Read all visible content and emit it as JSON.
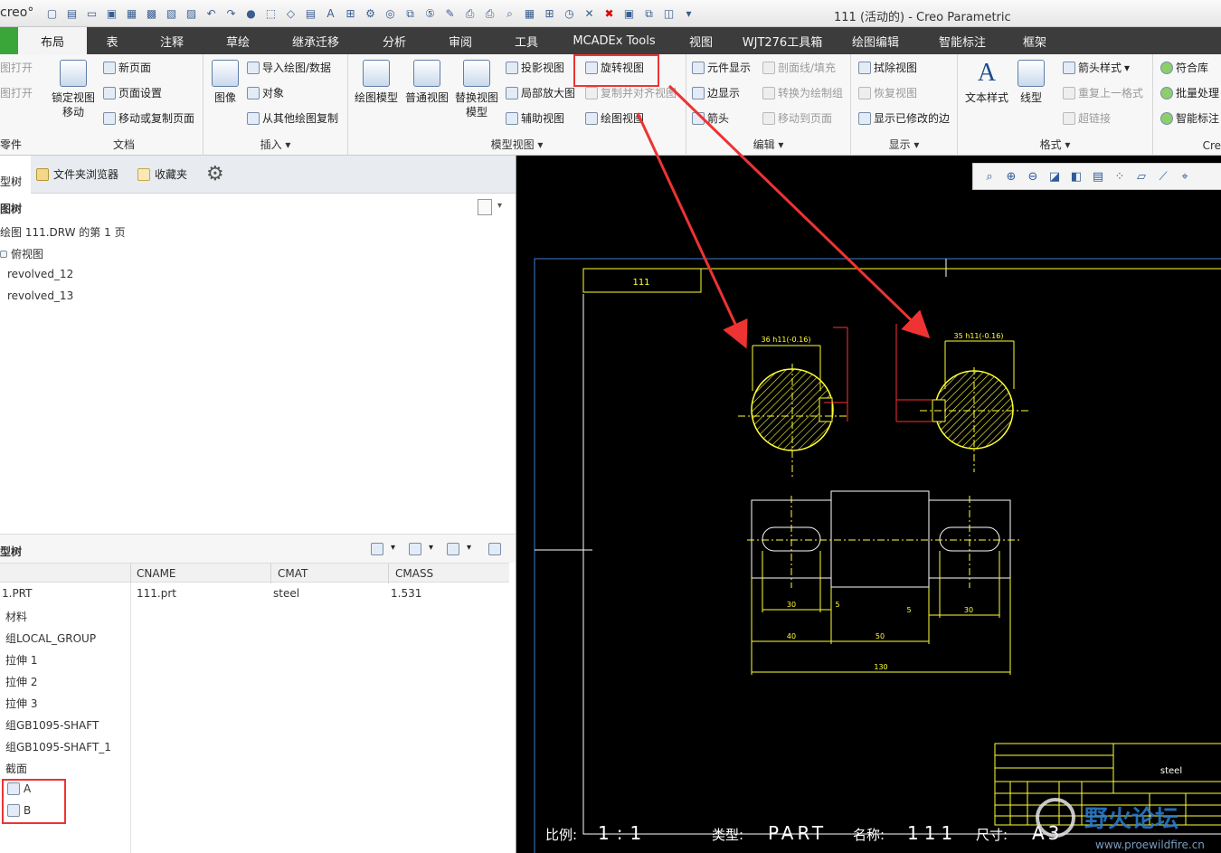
{
  "window": {
    "logo": "creo°",
    "title": "111 (活动的) - Creo Parametric"
  },
  "tabs": [
    "布局",
    "表",
    "注释",
    "草绘",
    "继承迁移",
    "分析",
    "审阅",
    "工具",
    "MCADEx Tools",
    "视图",
    "WJT276工具箱",
    "绘图编辑",
    "智能标注",
    "框架"
  ],
  "ribbon": {
    "doc": {
      "partial_left": [
        "图打开",
        "图打开"
      ],
      "lock_view": "锁定视图移动",
      "new_page": "新页面",
      "page_setup": "页面设置",
      "move_copy_page": "移动或复制页面",
      "label": "文档",
      "part_label": "零件"
    },
    "insert": {
      "image": "图像",
      "import": "导入绘图/数据",
      "object": "对象",
      "copy_from": "从其他绘图复制",
      "label": "插入"
    },
    "model_views": {
      "drawing_model": "绘图模型",
      "general_view": "普通视图",
      "replace_view": "替换视图模型",
      "projection": "投影视图",
      "detail": "局部放大图",
      "auxiliary": "辅助视图",
      "revolved": "旋转视图",
      "copy_align": "复制并对齐视图",
      "drawing_view": "绘图视图",
      "label": "模型视图"
    },
    "edit": {
      "component_display": "元件显示",
      "section_fill": "剖面线/填充",
      "edge_display": "边显示",
      "convert_draft": "转换为绘制组",
      "arrow": "箭头",
      "move_to_page": "移动到页面",
      "label": "编辑"
    },
    "display": {
      "erase_view": "拭除视图",
      "restore_view": "恢复视图",
      "show_modified": "显示已修改的边",
      "label": "显示"
    },
    "format": {
      "text_style": "文本样式",
      "line_style": "线型",
      "arrow_style": "箭头样式",
      "repeat_format": "重复上一格式",
      "hyperlink": "超链接",
      "label": "格式"
    },
    "creo_ext": {
      "conform_lib": "符合库",
      "batch": "批量处理",
      "smart_dim": "智能标注",
      "label": "Cre"
    }
  },
  "left_panel": {
    "tabs": {
      "model_tree": "型树",
      "folder_browser": "文件夹浏览器",
      "favorites": "收藏夹"
    },
    "drawing_tree": {
      "header": "图树",
      "items": [
        "绘图 111.DRW 的第 1 页",
        "俯视图",
        "revolved_12",
        "revolved_13"
      ]
    },
    "model_tree": {
      "header": "型树",
      "columns": [
        "CNAME",
        "CMAT",
        "CMASS"
      ],
      "root": {
        "name": "1.PRT",
        "cname": "111.prt",
        "cmat": "steel",
        "cmass": "1.531"
      },
      "items": [
        "材料",
        "组LOCAL_GROUP",
        "拉伸 1",
        "拉伸 2",
        "拉伸 3",
        "组GB1095-SHAFT",
        "组GB1095-SHAFT_1",
        "截面",
        "A",
        "B"
      ]
    }
  },
  "drawing": {
    "title_cell": "111",
    "material": "steel",
    "footer": {
      "scale_label": "比例:",
      "scale": "1:1",
      "type_label": "类型:",
      "type": "PART",
      "name_label": "名称:",
      "name": "111",
      "size_label": "尺寸:",
      "size": "A3"
    },
    "dims": {
      "d1": "36 h11(-0.16)",
      "d2": "35 h11(-0.16)",
      "w30a": "30",
      "w5a": "5",
      "w5b": "5",
      "w30b": "30",
      "w40": "40",
      "w50": "50",
      "w130": "130"
    },
    "watermark": "野火论坛",
    "watermark_url": "www.proewildfire.cn"
  },
  "colors": {
    "accent": "#e33333",
    "drawing_yellow": "#ffff33",
    "dim_red": "#ff3030",
    "ribbon_dark": "#3c3c3c"
  }
}
